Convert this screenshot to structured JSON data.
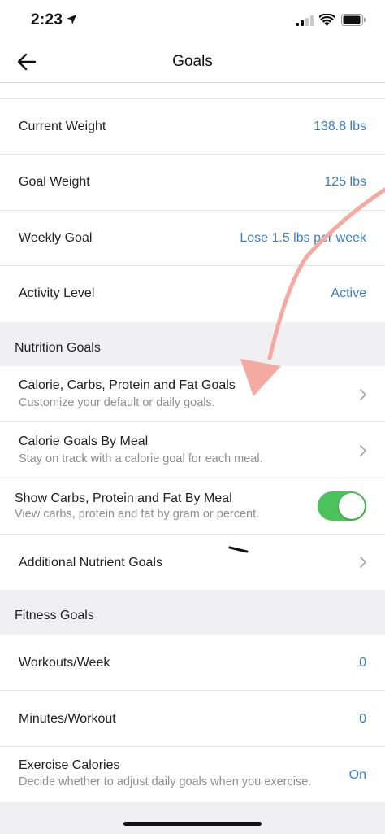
{
  "status_bar": {
    "time": "2:23"
  },
  "nav": {
    "title": "Goals"
  },
  "weight": {
    "current_label": "Current Weight",
    "current_value": "138.8 lbs",
    "goal_label": "Goal Weight",
    "goal_value": "125 lbs",
    "weekly_label": "Weekly Goal",
    "weekly_value": "Lose 1.5 lbs per week",
    "activity_label": "Activity Level",
    "activity_value": "Active"
  },
  "nutrition": {
    "section_title": "Nutrition Goals",
    "macro_title": "Calorie, Carbs, Protein and Fat Goals",
    "macro_sub": "Customize your default or daily goals.",
    "meal_title": "Calorie Goals By Meal",
    "meal_sub": "Stay on track with a calorie goal for each meal.",
    "show_title": "Show Carbs, Protein and Fat By Meal",
    "show_sub": "View carbs, protein and fat by gram or percent.",
    "show_toggle_on": true,
    "additional_title": "Additional Nutrient Goals"
  },
  "fitness": {
    "section_title": "Fitness Goals",
    "workouts_label": "Workouts/Week",
    "workouts_value": "0",
    "minutes_label": "Minutes/Workout",
    "minutes_value": "0",
    "exercise_label": "Exercise Calories",
    "exercise_sub": "Decide whether to adjust daily goals when you exercise.",
    "exercise_value": "On"
  },
  "colors": {
    "accent": "#3a7dc9",
    "toggle_on": "#4cc35a",
    "section_bg": "#f0f0f3",
    "annotation_arrow": "#f4aaa0"
  }
}
